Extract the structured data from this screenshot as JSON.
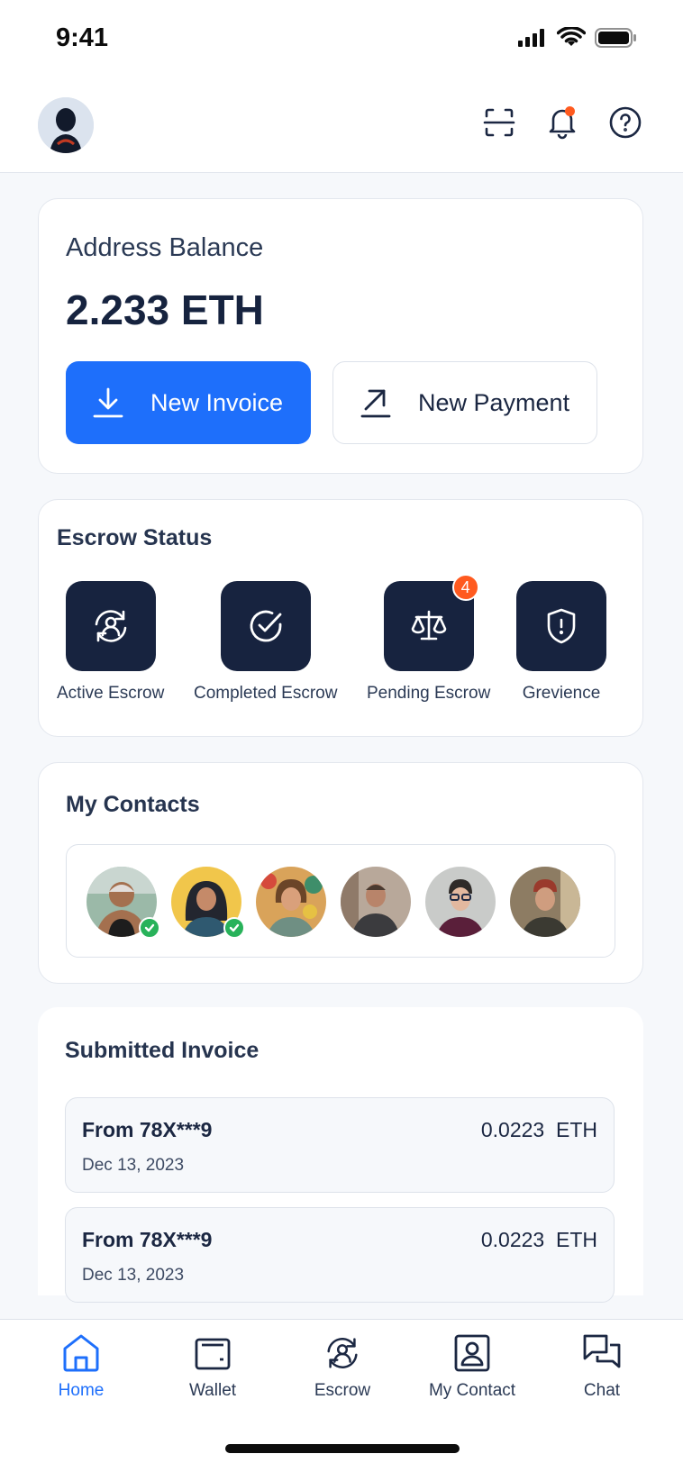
{
  "status_bar": {
    "time": "9:41"
  },
  "header": {
    "icons": [
      "avatar",
      "scan-icon",
      "bell-icon",
      "help-icon"
    ]
  },
  "balance": {
    "label": "Address Balance",
    "value": "2.233 ETH",
    "new_invoice": "New Invoice",
    "new_payment": "New Payment"
  },
  "escrow": {
    "title": "Escrow Status",
    "items": [
      {
        "label": "Active Escrow",
        "icon": "active-escrow-icon"
      },
      {
        "label": "Completed Escrow",
        "icon": "check-circle-icon"
      },
      {
        "label": "Pending Escrow",
        "icon": "scale-icon",
        "badge": "4"
      },
      {
        "label": "Grevience",
        "icon": "shield-alert-icon"
      }
    ]
  },
  "contacts": {
    "title": "My Contacts",
    "count": 6
  },
  "invoices": {
    "title": "Submitted Invoice",
    "items": [
      {
        "from": "From 78X***9",
        "date": "Dec 13, 2023",
        "amount": "0.0223",
        "unit": "ETH"
      },
      {
        "from": "From 78X***9",
        "date": "Dec 13, 2023",
        "amount": "0.0223",
        "unit": "ETH"
      }
    ]
  },
  "tabs": [
    {
      "label": "Home",
      "active": true
    },
    {
      "label": "Wallet",
      "active": false
    },
    {
      "label": "Escrow",
      "active": false
    },
    {
      "label": "My Contact",
      "active": false
    },
    {
      "label": "Chat",
      "active": false
    }
  ],
  "colors": {
    "primary": "#1e6ffb",
    "navy": "#17233f",
    "badge": "#ff5a1f",
    "verified": "#28b25a"
  }
}
